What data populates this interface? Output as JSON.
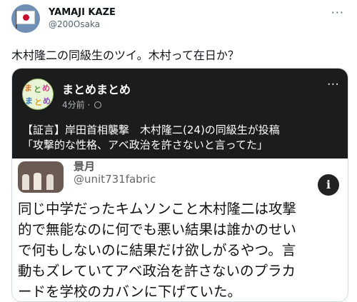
{
  "tweet": {
    "author_name": "YAMAJI KAZE",
    "author_handle": "@200Osaka",
    "more_icon": "more-icon",
    "text": "木村隆二の同級生のツイ。木村って在日か？"
  },
  "embedded_post": {
    "channel_name": "まとめまとめ",
    "avatar_text": [
      "ま",
      "と",
      "め",
      "ま",
      "と",
      "め"
    ],
    "time": "4分前 ·",
    "headline_lines": [
      "【証言】岸田首相襲撃　木村隆二(24)の同級生が投稿",
      "「攻撃的な性格、アベ政治を許さないと言ってた」"
    ],
    "inner_tweet": {
      "name": "景月",
      "handle": "@unit731fabric",
      "info_icon": "i",
      "body_lines": [
        "同じ中学だったキムソンこと木村隆二は攻撃",
        "的で無能なのに何でも悪い結果は誰かのせい",
        "で何もしないのに結果だけ欲しがるやつ。言",
        "動もズレていてアベ政治を許さないのプラカ",
        "ードを学校のカバンに下げていた。"
      ]
    }
  },
  "colors": {
    "dark_panel": "#1c1c1c",
    "handle_gray": "#536471",
    "flag_red": "#c8102e"
  }
}
